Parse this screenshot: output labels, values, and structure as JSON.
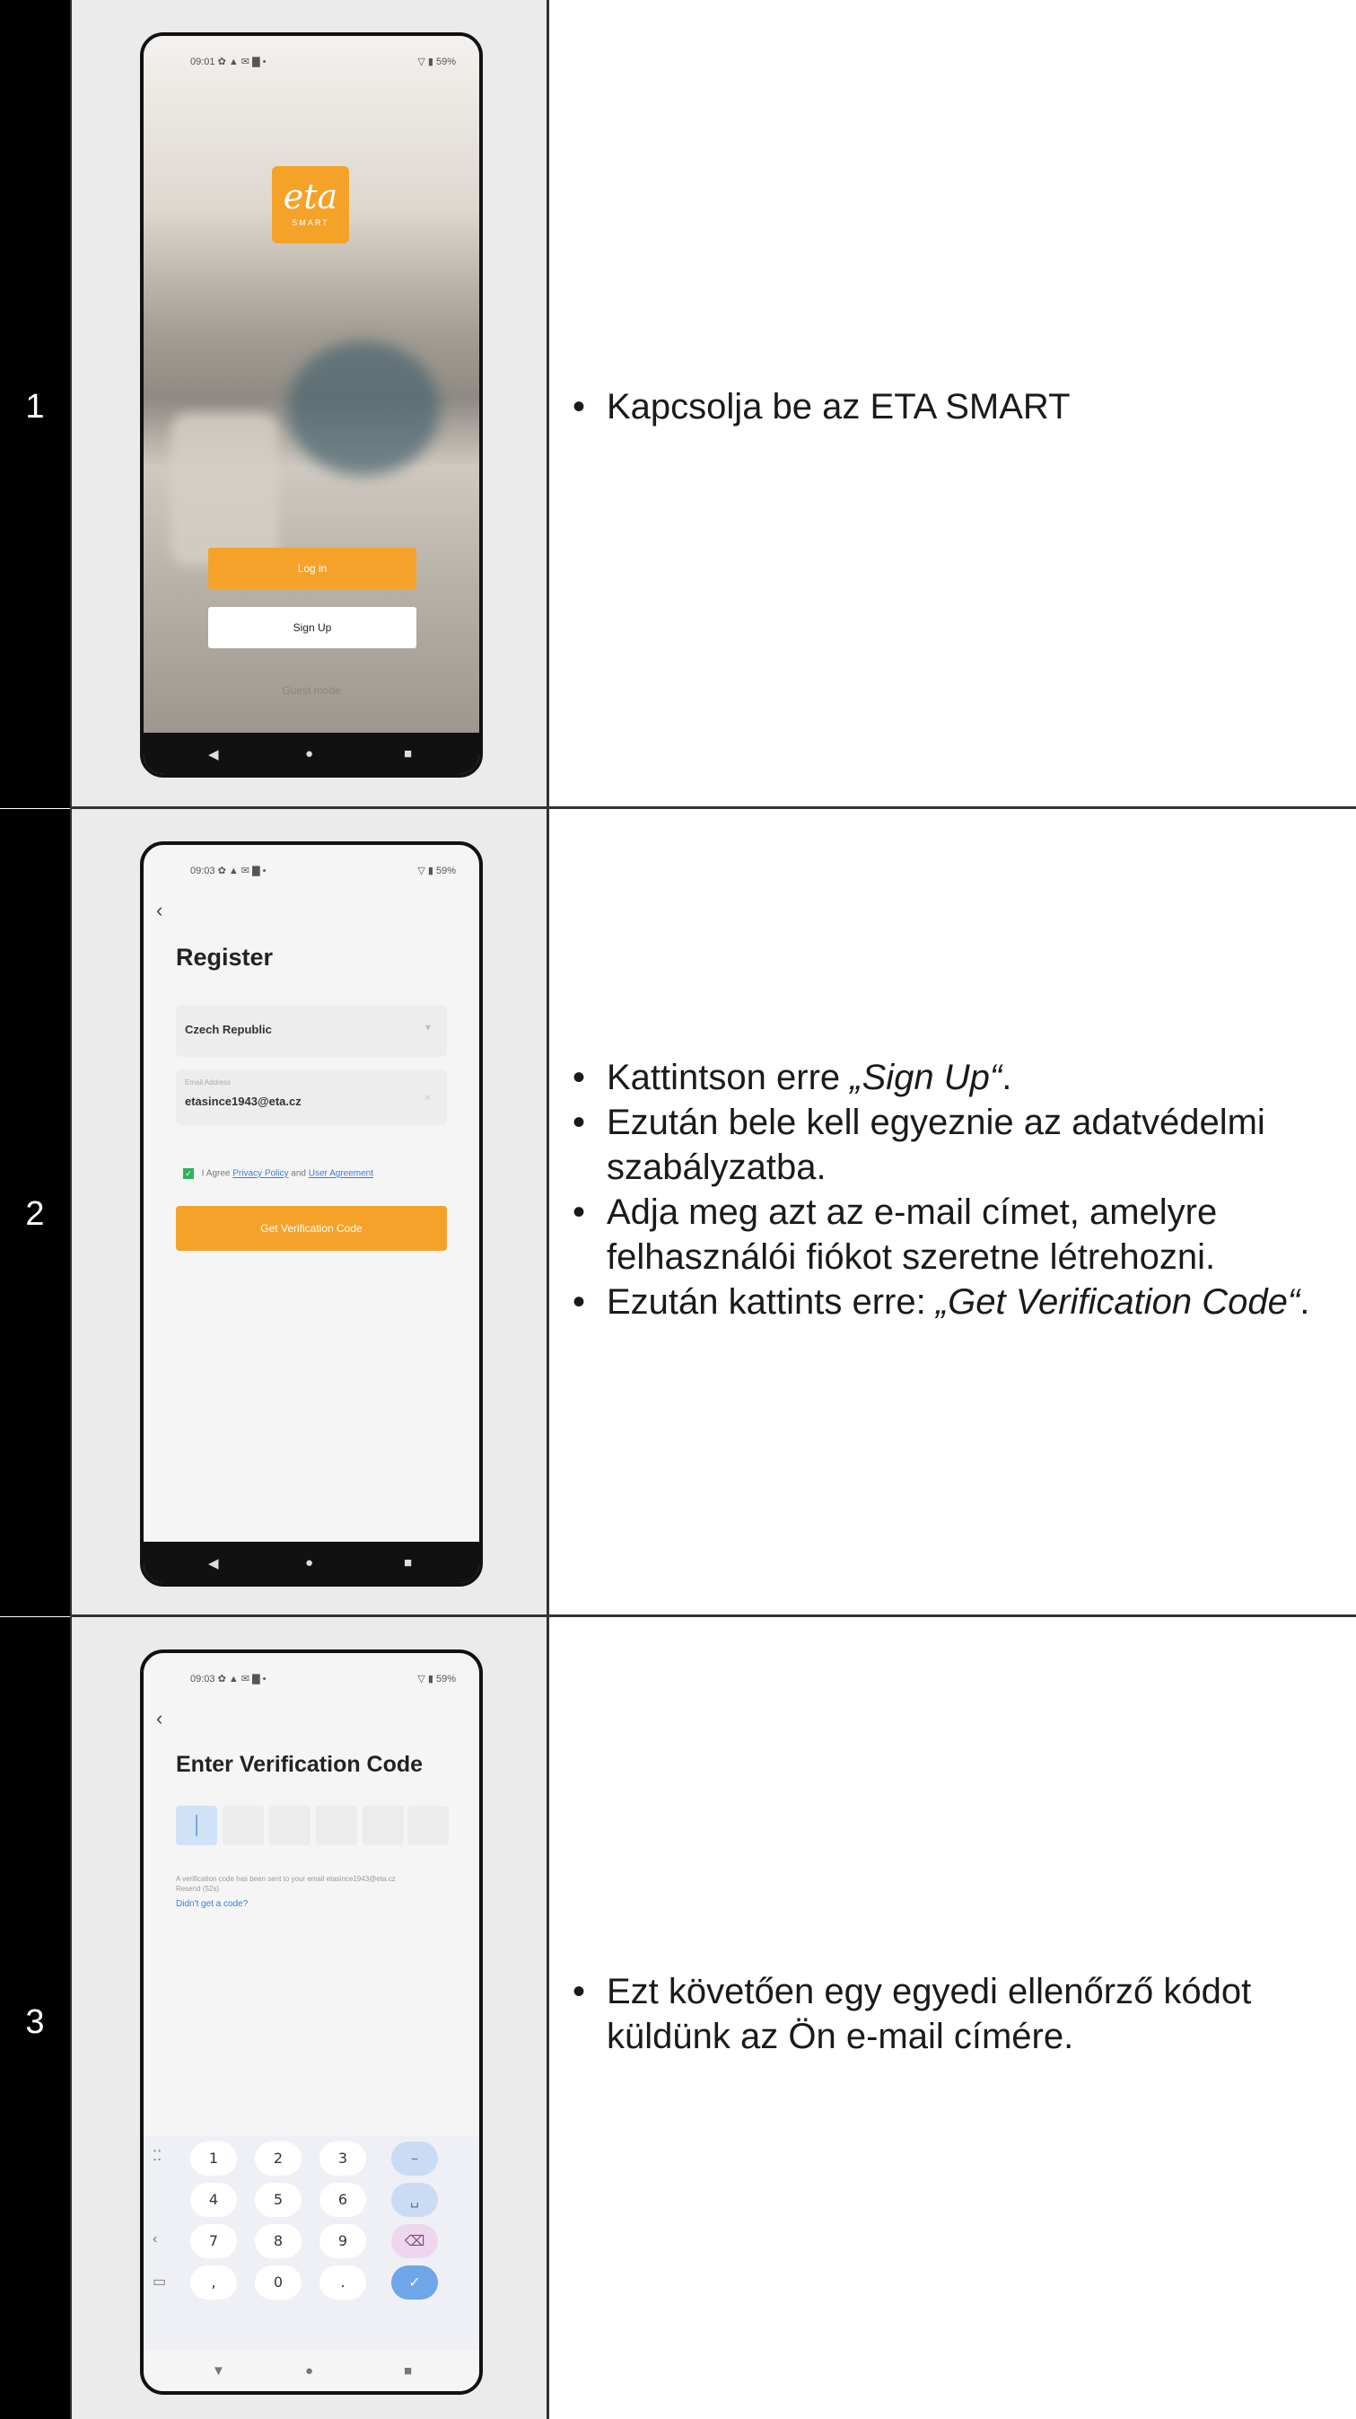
{
  "rows": [
    {
      "number": "1",
      "phone": {
        "status_time": "09:01 ✿ ▲ ✉ ▇ •",
        "status_right": "▽ ▮ 59%",
        "logo_text": "eta",
        "logo_sub": "SMART",
        "login_label": "Log in",
        "signup_label": "Sign Up",
        "guest_label": "Guest mode"
      },
      "text": {
        "bullet1": "Kapcsolja be az ETA SMART"
      }
    },
    {
      "number": "2",
      "phone": {
        "status_time": "09:03 ✿ ▲ ✉ ▇ •",
        "status_right": "▽ ▮ 59%",
        "title": "Register",
        "country": "Czech Republic",
        "email_label": "Email Address",
        "email_value": "etasince1943@eta.cz",
        "agree_prefix": "I Agree",
        "privacy_link": "Privacy Policy",
        "agree_and": "and",
        "user_link": "User Agreement",
        "verify_button": "Get Verification Code"
      },
      "text": {
        "b1_pre": "Kattintson erre ",
        "b1_em": "„Sign Up“",
        "b1_post": ".",
        "b2": "Ezután bele kell egyeznie az adatvédelmi szabályzatba.",
        "b3": "Adja meg azt az e-mail címet, amelyre felhasználói fiókot szeretne létrehozni.",
        "b4_pre": "Ezután kattints erre: ",
        "b4_em": "„Get Verification Code“",
        "b4_post": "."
      }
    },
    {
      "number": "3",
      "phone": {
        "status_time": "09:03 ✿ ▲ ✉ ▇ •",
        "status_right": "▽ ▮ 59%",
        "title": "Enter Verification Code",
        "sent_message": "A verification code has been sent to your email etasince1943@eta.cz Resend (52s)",
        "no_code": "Didn't get a code?",
        "keys": [
          "1",
          "2",
          "3",
          "–",
          "4",
          "5",
          "6",
          "␣",
          "7",
          "8",
          "9",
          "⌫",
          ",",
          "0",
          ".",
          "✓"
        ]
      },
      "text": {
        "bullet1": "Ezt követően egy egyedi ellenőrző kódot küldünk az Ön e-mail címére."
      }
    }
  ]
}
